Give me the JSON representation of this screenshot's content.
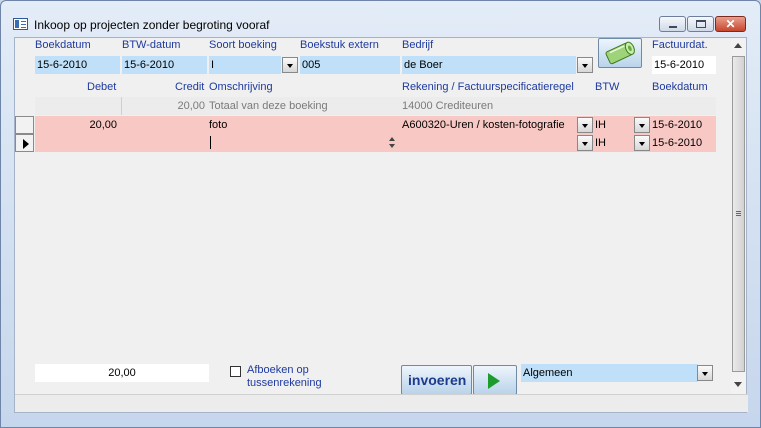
{
  "window": {
    "title": "Inkoop op projecten zonder begroting vooraf"
  },
  "header": {
    "labels": {
      "boekdatum": "Boekdatum",
      "btw_datum": "BTW-datum",
      "soort_boeking": "Soort boeking",
      "boekstuk_extern": "Boekstuk extern",
      "bedrijf": "Bedrijf",
      "factuurdat": "Factuurdat."
    },
    "values": {
      "boekdatum": "15-6-2010",
      "btw_datum": "15-6-2010",
      "soort_boeking": "I",
      "boekstuk_extern": "005",
      "bedrijf": "de Boer",
      "factuurdat": "15-6-2010"
    }
  },
  "grid": {
    "columns": {
      "debet": "Debet",
      "credit": "Credit",
      "omschrijving": "Omschrijving",
      "rekening": "Rekening / Factuurspecificatieregel",
      "btw": "BTW",
      "boekdatum": "Boekdatum"
    },
    "total_row": {
      "credit": "20,00",
      "omschrijving": "Totaal van deze boeking",
      "rekening": "14000  Crediteuren"
    },
    "rows": [
      {
        "debet": "20,00",
        "omschrijving": "foto",
        "rekening": "A600320-Uren / kosten-fotografie",
        "btw": "IH",
        "boekdatum": "15-6-2010"
      },
      {
        "debet": "",
        "omschrijving": "",
        "rekening": "",
        "btw": "IH",
        "boekdatum": "15-6-2010"
      }
    ]
  },
  "footer": {
    "total": "20,00",
    "afboeken_label_line1": "Afboeken op",
    "afboeken_label_line2": "tussenrekening",
    "invoeren_label": "invoeren",
    "algemeen_value": "Algemeen"
  },
  "colors": {
    "label_blue": "#1e3a9e",
    "field_blue": "#bfe0f8",
    "row_pink": "#f8c8c4",
    "play_green": "#1d9b2c"
  },
  "icons": [
    "form-icon",
    "minimize-icon",
    "maximize-icon",
    "close-icon",
    "money-roll-icon",
    "dropdown-arrow-icon",
    "record-selector-icon",
    "play-icon"
  ]
}
